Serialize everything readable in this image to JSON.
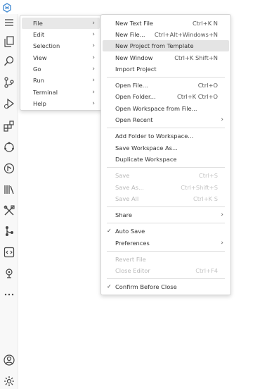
{
  "main_menu": {
    "items": [
      {
        "label": "File"
      },
      {
        "label": "Edit"
      },
      {
        "label": "Selection"
      },
      {
        "label": "View"
      },
      {
        "label": "Go"
      },
      {
        "label": "Run"
      },
      {
        "label": "Terminal"
      },
      {
        "label": "Help"
      }
    ]
  },
  "file_menu": {
    "new_text_file": {
      "label": "New Text File",
      "shortcut": "Ctrl+K N"
    },
    "new_file": {
      "label": "New File...",
      "shortcut": "Ctrl+Alt+Windows+N"
    },
    "new_project_from_template": {
      "label": "New Project from Template"
    },
    "new_window": {
      "label": "New Window",
      "shortcut": "Ctrl+K Shift+N"
    },
    "import_project": {
      "label": "Import Project"
    },
    "open_file": {
      "label": "Open File...",
      "shortcut": "Ctrl+O"
    },
    "open_folder": {
      "label": "Open Folder...",
      "shortcut": "Ctrl+K Ctrl+O"
    },
    "open_workspace": {
      "label": "Open Workspace from File..."
    },
    "open_recent": {
      "label": "Open Recent"
    },
    "add_folder": {
      "label": "Add Folder to Workspace..."
    },
    "save_workspace_as": {
      "label": "Save Workspace As..."
    },
    "duplicate_workspace": {
      "label": "Duplicate Workspace"
    },
    "save": {
      "label": "Save",
      "shortcut": "Ctrl+S"
    },
    "save_as": {
      "label": "Save As...",
      "shortcut": "Ctrl+Shift+S"
    },
    "save_all": {
      "label": "Save All",
      "shortcut": "Ctrl+K S"
    },
    "share": {
      "label": "Share"
    },
    "auto_save": {
      "label": "Auto Save",
      "check": "✓"
    },
    "preferences": {
      "label": "Preferences"
    },
    "revert_file": {
      "label": "Revert File"
    },
    "close_editor": {
      "label": "Close Editor",
      "shortcut": "Ctrl+F4"
    },
    "confirm_before_close": {
      "label": "Confirm Before Close",
      "check": "✓"
    }
  },
  "activity_bar": {
    "icons": [
      "menu-icon",
      "explorer-icon",
      "search-icon",
      "source-control-icon",
      "run-debug-icon",
      "extensions-icon",
      "cloud-icon",
      "git-graph-icon",
      "library-icon",
      "tools-icon",
      "branch-icon",
      "code-file-icon",
      "deploy-icon",
      "more-icon",
      "account-icon",
      "settings-gear-icon"
    ]
  },
  "colors": {
    "menu_bg": "#ffffff",
    "menu_border": "#d4d4d4",
    "hover_bg": "#e4e4e4",
    "text": "#333333",
    "disabled_text": "#b8b8b8",
    "logo_blue": "#4a8fd4"
  }
}
